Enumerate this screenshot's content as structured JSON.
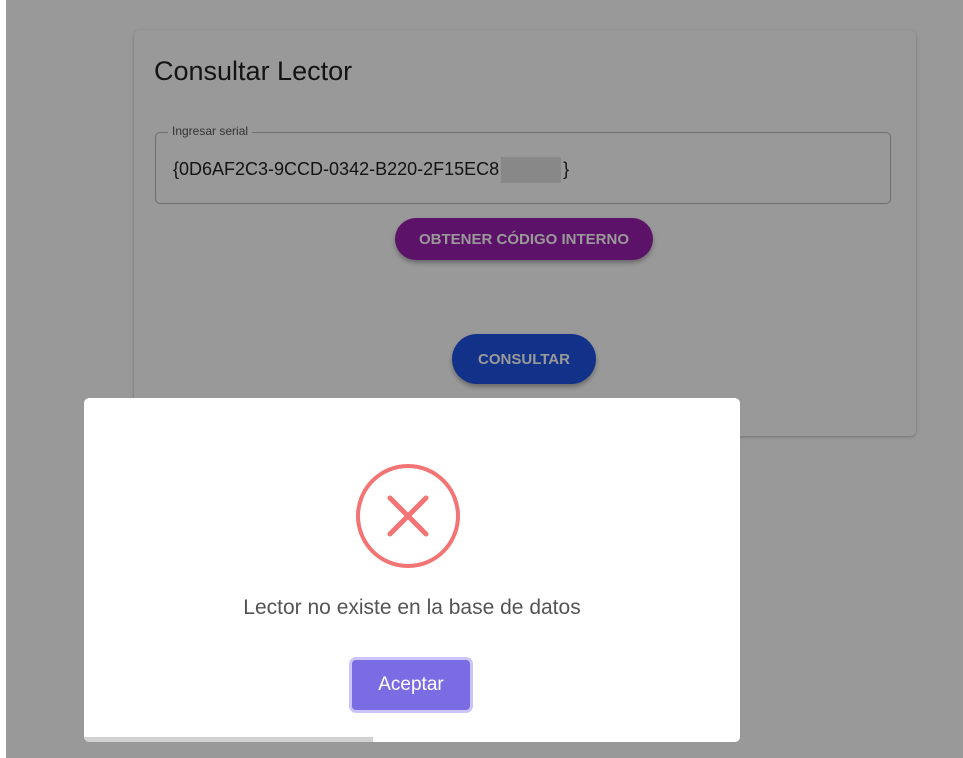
{
  "card": {
    "title": "Consultar Lector",
    "serial_field": {
      "label": "Ingresar serial",
      "value_prefix": "{0D6AF2C3-9CCD-0342-B220-2F15EC8",
      "value_suffix": "}"
    },
    "internal_code_button": "OBTENER CÓDIGO INTERNO",
    "consult_button": "CONSULTAR"
  },
  "dialog": {
    "icon": "error-x-icon",
    "message": "Lector no existe en la base de datos",
    "accept_button": "Aceptar",
    "timer_progress": 0.44
  },
  "colors": {
    "internal_button": "#9a1fad",
    "consult_button": "#1f52e3",
    "accept_button": "#7a6de3",
    "error_icon": "#f27474"
  }
}
